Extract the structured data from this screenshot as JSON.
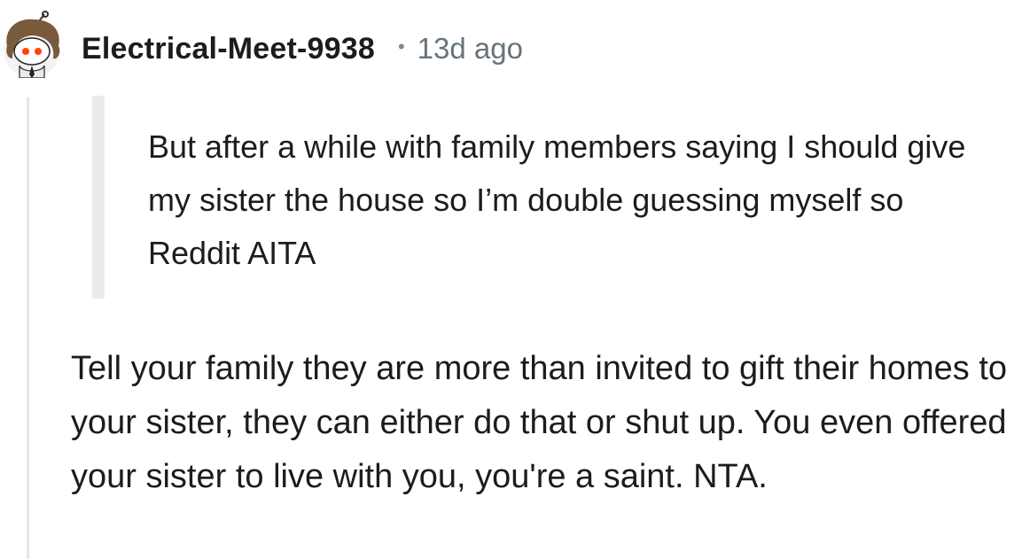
{
  "comment": {
    "author": "Electrical-Meet-9938",
    "separator": "•",
    "timestamp": "13d ago",
    "avatar_icon": "snoo-avatar-icon",
    "quote": "But after a while with family members saying I should give my sister the house so I’m double guessing myself so Reddit AITA",
    "body": "Tell your family they are more than invited to gift their homes to your sister, they can either do that or shut up. You even offered your sister to live with you, you're a saint. NTA."
  },
  "colors": {
    "text": "#1c1c1c",
    "meta": "#66737c",
    "thread_line": "#e4e6e8",
    "quote_bar": "#ebebeb",
    "avatar_accent": "#ff4500"
  }
}
